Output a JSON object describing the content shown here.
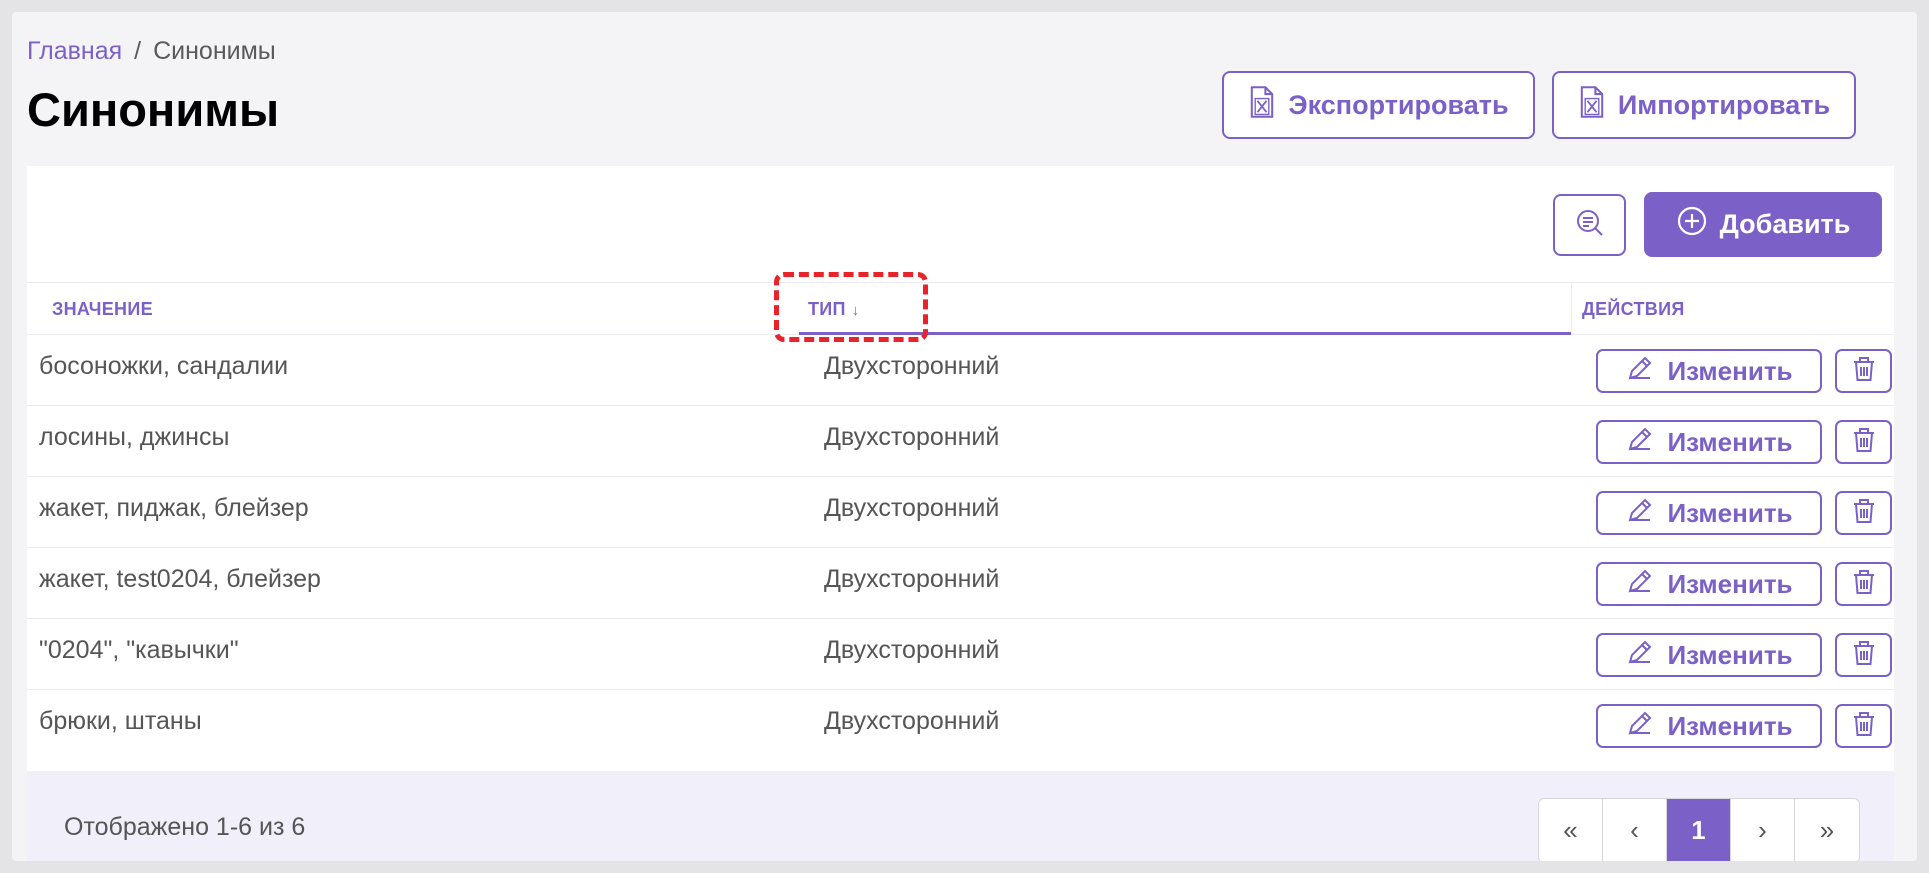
{
  "breadcrumb": {
    "home": "Главная",
    "separator": "/",
    "current": "Синонимы"
  },
  "page": {
    "title": "Синонимы"
  },
  "toolbar": {
    "export_label": "Экспортировать",
    "import_label": "Импортировать",
    "add_label": "Добавить"
  },
  "table": {
    "columns": {
      "value": "ЗНАЧЕНИЕ",
      "type": "ТИП",
      "type_sort": "↓",
      "actions": "ДЕЙСТВИЯ"
    },
    "edit_label": "Изменить",
    "rows": [
      {
        "value": "босоножки, сандалии",
        "type": "Двухсторонний"
      },
      {
        "value": "лосины, джинсы",
        "type": "Двухсторонний"
      },
      {
        "value": "жакет, пиджак, блейзер",
        "type": "Двухсторонний"
      },
      {
        "value": "жакет, test0204, блейзер",
        "type": "Двухсторонний"
      },
      {
        "value": "\"0204\", \"кавычки\"",
        "type": "Двухсторонний"
      },
      {
        "value": "брюки, штаны",
        "type": "Двухсторонний"
      }
    ]
  },
  "footer": {
    "shown_text": "Отображено 1-6 из 6",
    "pagination": {
      "first": "«",
      "prev": "‹",
      "current": "1",
      "next": "›",
      "last": "»"
    }
  },
  "colors": {
    "accent": "#7b61c7",
    "highlight": "#e8232a"
  }
}
